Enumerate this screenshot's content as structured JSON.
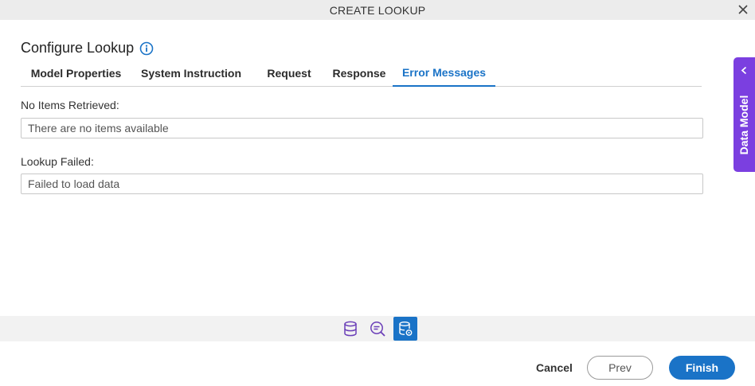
{
  "window": {
    "title": "CREATE LOOKUP"
  },
  "heading": {
    "title": "Configure Lookup"
  },
  "tabs": [
    {
      "label": "Model Properties",
      "active": false
    },
    {
      "label": "System Instruction",
      "active": false
    },
    {
      "label": "Request",
      "active": false
    },
    {
      "label": "Response",
      "active": false
    },
    {
      "label": "Error Messages",
      "active": true
    }
  ],
  "fields": {
    "no_items": {
      "label": "No Items Retrieved:",
      "value": "There are no items available"
    },
    "lookup_failed": {
      "label": "Lookup Failed:",
      "value": "Failed to load data"
    }
  },
  "side_panel": {
    "label": "Data Model"
  },
  "toolbar": {
    "icons": [
      "database-icon",
      "search-lines-icon",
      "database-gear-icon"
    ],
    "active_index": 2
  },
  "footer": {
    "cancel": "Cancel",
    "prev": "Prev",
    "finish": "Finish"
  },
  "colors": {
    "accent": "#1a73c7",
    "side_panel": "#7b3fe0"
  }
}
